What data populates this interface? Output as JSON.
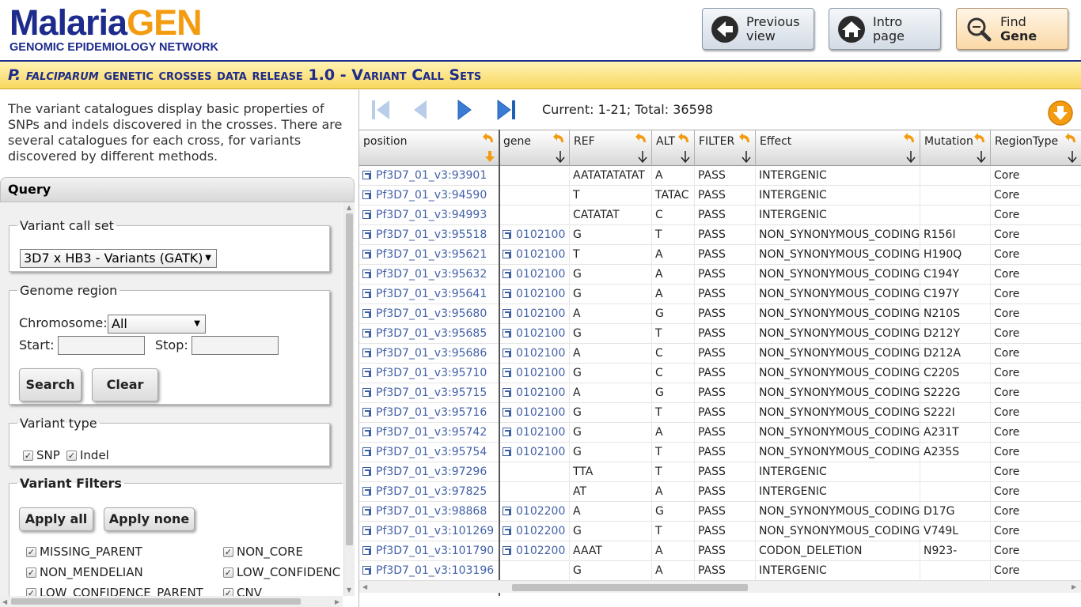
{
  "header": {
    "logo_part1": "Malaria",
    "logo_part2": "GEN",
    "logo_tagline": "GENOMIC EPIDEMIOLOGY NETWORK",
    "buttons": {
      "previous": {
        "line1": "Previous",
        "line2": "view",
        "icon": "left-arrow-icon"
      },
      "intro": {
        "line1": "Intro",
        "line2": "page",
        "icon": "home-icon"
      },
      "find": {
        "line1": "Find",
        "line2": "Gene",
        "icon": "magnifier-icon"
      }
    },
    "title_species": "P. falciparum",
    "title_rest": " genetic crosses data release 1.0 - Variant Call Sets",
    "colors": {
      "brand_blue": "#1d2b8c",
      "brand_orange": "#f39c12",
      "titlebar": "#f8d75e"
    }
  },
  "intro_text": "The variant catalogues display basic properties of SNPs and indels discovered in the crosses. There are several catalogues for each cross, for variants discovered by different methods.",
  "query": {
    "title": "Query",
    "variant_call_set": {
      "legend": "Variant call set",
      "selected": "3D7 x HB3 - Variants (GATK)"
    },
    "genome_region": {
      "legend": "Genome region",
      "chromosome_label": "Chromosome:",
      "chromosome_selected": "All",
      "start_label": "Start:",
      "stop_label": "Stop:",
      "start_value": "",
      "stop_value": "",
      "search_button": "Search",
      "clear_button": "Clear"
    },
    "variant_type": {
      "legend": "Variant type",
      "snp": "SNP",
      "indel": "Indel",
      "snp_checked": true,
      "indel_checked": true
    },
    "variant_filters": {
      "legend": "Variant Filters",
      "apply_all": "Apply all",
      "apply_none": "Apply none",
      "filters": [
        "MISSING_PARENT",
        "NON_CORE",
        "NON_MENDELIAN",
        "LOW_CONFIDENC",
        "LOW_CONFIDENCE_PARENT",
        "CNV"
      ]
    }
  },
  "grid": {
    "pager_text": "Current: 1-21; Total: 36598",
    "columns": [
      "position",
      "gene",
      "REF",
      "ALT",
      "FILTER",
      "Effect",
      "Mutation",
      "RegionType"
    ],
    "rows": [
      {
        "position": "Pf3D7_01_v3:93901",
        "gene": "",
        "ref": "AATATATATAT",
        "alt": "A",
        "filter": "PASS",
        "effect": "INTERGENIC",
        "mutation": "",
        "region": "Core"
      },
      {
        "position": "Pf3D7_01_v3:94590",
        "gene": "",
        "ref": "T",
        "alt": "TATAC",
        "filter": "PASS",
        "effect": "INTERGENIC",
        "mutation": "",
        "region": "Core"
      },
      {
        "position": "Pf3D7_01_v3:94993",
        "gene": "",
        "ref": "CATATAT",
        "alt": "C",
        "filter": "PASS",
        "effect": "INTERGENIC",
        "mutation": "",
        "region": "Core"
      },
      {
        "position": "Pf3D7_01_v3:95518",
        "gene": "0102100",
        "ref": "G",
        "alt": "T",
        "filter": "PASS",
        "effect": "NON_SYNONYMOUS_CODING",
        "mutation": "R156I",
        "region": "Core"
      },
      {
        "position": "Pf3D7_01_v3:95621",
        "gene": "0102100",
        "ref": "T",
        "alt": "A",
        "filter": "PASS",
        "effect": "NON_SYNONYMOUS_CODING",
        "mutation": "H190Q",
        "region": "Core"
      },
      {
        "position": "Pf3D7_01_v3:95632",
        "gene": "0102100",
        "ref": "G",
        "alt": "A",
        "filter": "PASS",
        "effect": "NON_SYNONYMOUS_CODING",
        "mutation": "C194Y",
        "region": "Core"
      },
      {
        "position": "Pf3D7_01_v3:95641",
        "gene": "0102100",
        "ref": "G",
        "alt": "A",
        "filter": "PASS",
        "effect": "NON_SYNONYMOUS_CODING",
        "mutation": "C197Y",
        "region": "Core"
      },
      {
        "position": "Pf3D7_01_v3:95680",
        "gene": "0102100",
        "ref": "A",
        "alt": "G",
        "filter": "PASS",
        "effect": "NON_SYNONYMOUS_CODING",
        "mutation": "N210S",
        "region": "Core"
      },
      {
        "position": "Pf3D7_01_v3:95685",
        "gene": "0102100",
        "ref": "G",
        "alt": "T",
        "filter": "PASS",
        "effect": "NON_SYNONYMOUS_CODING",
        "mutation": "D212Y",
        "region": "Core"
      },
      {
        "position": "Pf3D7_01_v3:95686",
        "gene": "0102100",
        "ref": "A",
        "alt": "C",
        "filter": "PASS",
        "effect": "NON_SYNONYMOUS_CODING",
        "mutation": "D212A",
        "region": "Core"
      },
      {
        "position": "Pf3D7_01_v3:95710",
        "gene": "0102100",
        "ref": "G",
        "alt": "C",
        "filter": "PASS",
        "effect": "NON_SYNONYMOUS_CODING",
        "mutation": "C220S",
        "region": "Core"
      },
      {
        "position": "Pf3D7_01_v3:95715",
        "gene": "0102100",
        "ref": "A",
        "alt": "G",
        "filter": "PASS",
        "effect": "NON_SYNONYMOUS_CODING",
        "mutation": "S222G",
        "region": "Core"
      },
      {
        "position": "Pf3D7_01_v3:95716",
        "gene": "0102100",
        "ref": "G",
        "alt": "T",
        "filter": "PASS",
        "effect": "NON_SYNONYMOUS_CODING",
        "mutation": "S222I",
        "region": "Core"
      },
      {
        "position": "Pf3D7_01_v3:95742",
        "gene": "0102100",
        "ref": "G",
        "alt": "A",
        "filter": "PASS",
        "effect": "NON_SYNONYMOUS_CODING",
        "mutation": "A231T",
        "region": "Core"
      },
      {
        "position": "Pf3D7_01_v3:95754",
        "gene": "0102100",
        "ref": "G",
        "alt": "T",
        "filter": "PASS",
        "effect": "NON_SYNONYMOUS_CODING",
        "mutation": "A235S",
        "region": "Core"
      },
      {
        "position": "Pf3D7_01_v3:97296",
        "gene": "",
        "ref": "TTA",
        "alt": "T",
        "filter": "PASS",
        "effect": "INTERGENIC",
        "mutation": "",
        "region": "Core"
      },
      {
        "position": "Pf3D7_01_v3:97825",
        "gene": "",
        "ref": "AT",
        "alt": "A",
        "filter": "PASS",
        "effect": "INTERGENIC",
        "mutation": "",
        "region": "Core"
      },
      {
        "position": "Pf3D7_01_v3:98868",
        "gene": "0102200",
        "ref": "A",
        "alt": "G",
        "filter": "PASS",
        "effect": "NON_SYNONYMOUS_CODING",
        "mutation": "D17G",
        "region": "Core"
      },
      {
        "position": "Pf3D7_01_v3:101269",
        "gene": "0102200",
        "ref": "G",
        "alt": "T",
        "filter": "PASS",
        "effect": "NON_SYNONYMOUS_CODING",
        "mutation": "V749L",
        "region": "Core"
      },
      {
        "position": "Pf3D7_01_v3:101790",
        "gene": "0102200",
        "ref": "AAAT",
        "alt": "A",
        "filter": "PASS",
        "effect": "CODON_DELETION",
        "mutation": "N923-",
        "region": "Core"
      },
      {
        "position": "Pf3D7_01_v3:103196",
        "gene": "",
        "ref": "G",
        "alt": "A",
        "filter": "PASS",
        "effect": "INTERGENIC",
        "mutation": "",
        "region": "Core"
      }
    ]
  }
}
